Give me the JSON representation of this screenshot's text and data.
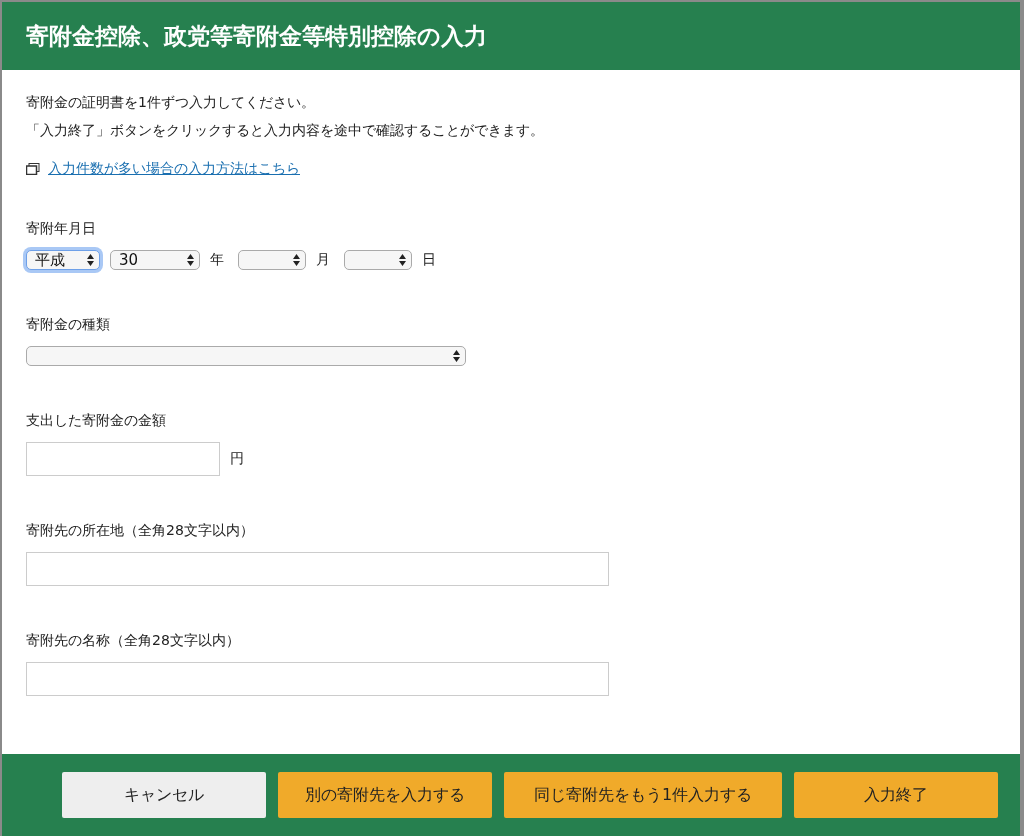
{
  "dialog": {
    "title": "寄附金控除、政党等寄附金等特別控除の入力",
    "intro": [
      "寄附金の証明書を1件ずつ入力してください。",
      "「入力終了」ボタンをクリックすると入力内容を途中で確認することができます。"
    ],
    "link": "入力件数が多い場合の入力方法はこちら",
    "fields": [
      {
        "kind": "date",
        "label": "寄附年月日",
        "parts": [
          {
            "value": "平成",
            "focused": true
          },
          {
            "value": "30",
            "focused": false,
            "suffix": "年"
          },
          {
            "focused": false,
            "suffix": "月"
          },
          {
            "focused": false,
            "suffix": "日"
          }
        ]
      },
      {
        "kind": "select",
        "label": "寄附金の種類"
      },
      {
        "kind": "amount",
        "label": "支出した寄附金の金額",
        "unit": "円"
      },
      {
        "kind": "text",
        "label": "寄附先の所在地（全角28文字以内）"
      },
      {
        "kind": "text",
        "label": "寄附先の名称（全角28文字以内）"
      }
    ],
    "buttons": [
      {
        "label": "キャンセル",
        "kind": "secondary"
      },
      {
        "label": "別の寄附先を入力する",
        "kind": "primary"
      },
      {
        "label": "同じ寄附先をもう1件入力する",
        "kind": "primary"
      },
      {
        "label": "入力終了",
        "kind": "primary"
      }
    ]
  }
}
